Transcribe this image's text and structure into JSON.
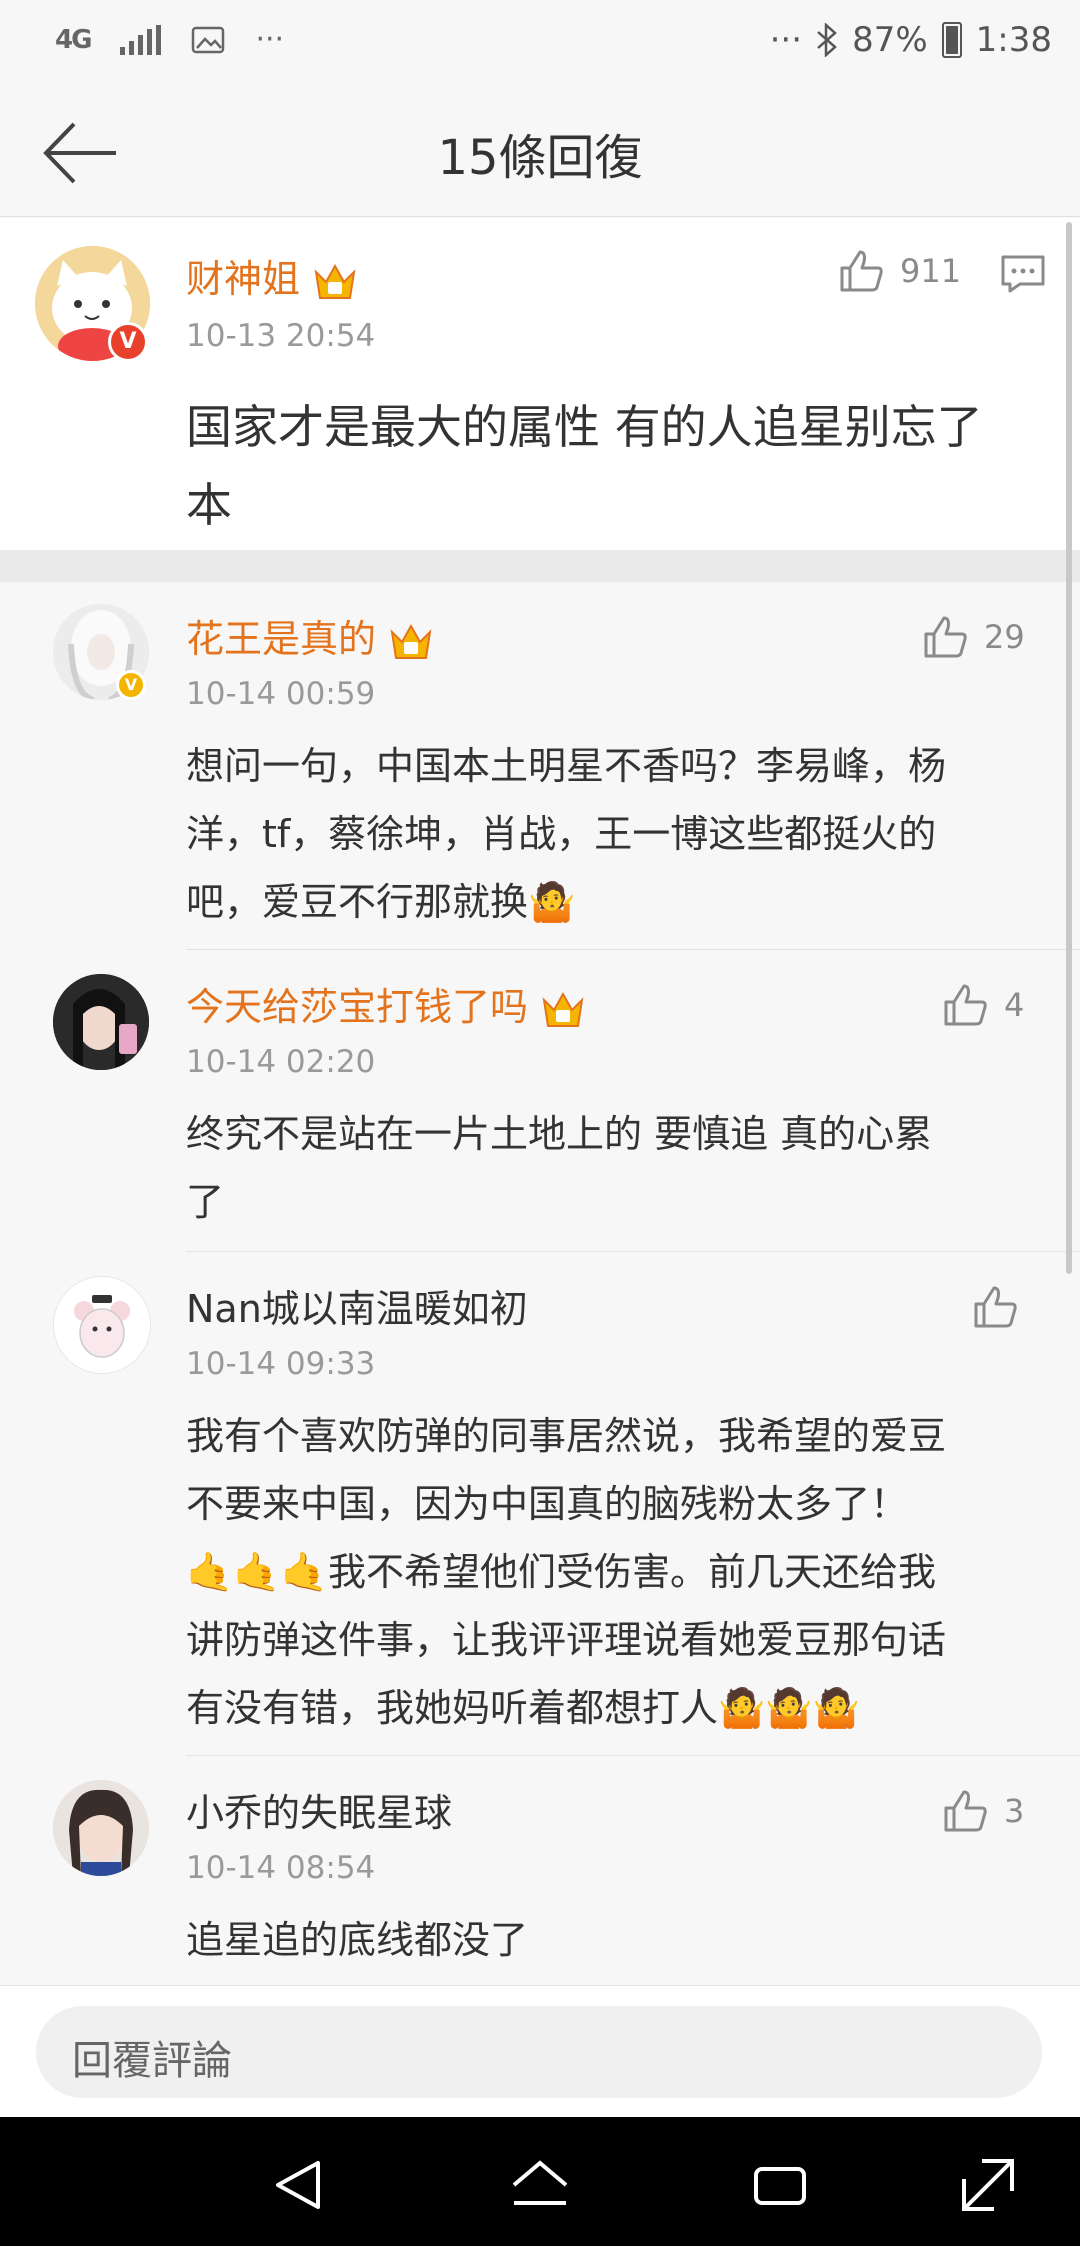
{
  "status_bar": {
    "network": "4G",
    "more_left": "···",
    "more_right": "···",
    "battery": "87%",
    "time": "1:38"
  },
  "header": {
    "title": "15條回復"
  },
  "main_comment": {
    "user": "财神姐",
    "time": "10-13 20:54",
    "likes": "911",
    "text_lines": [
      "国家才是最大的属性 有的人追星别忘了",
      "本"
    ]
  },
  "replies": [
    {
      "user": "花王是真的",
      "time": "10-14 00:59",
      "likes": "29",
      "text_lines": [
        "想问一句，中国本土明星不香吗？李易峰，杨",
        "洋，tf，蔡徐坤，肖战，王一博这些都挺火的",
        "吧，爱豆不行那就换🤷"
      ]
    },
    {
      "user": "今天给莎宝打钱了吗",
      "time": "10-14 02:20",
      "likes": "4",
      "text_lines": [
        "终究不是站在一片土地上的 要慎追 真的心累",
        "了"
      ]
    },
    {
      "user": "Nan城以南温暖如初",
      "time": "10-14 09:33",
      "likes": "",
      "text_lines": [
        "我有个喜欢防弹的同事居然说，我希望的爱豆",
        "不要来中国，因为中国真的脑残粉太多了！",
        "🤙🤙🤙我不希望他们受伤害。前几天还给我",
        "讲防弹这件事，让我评评理说看她爱豆那句话",
        "有没有错，我她妈听着都想打人🤷🤷🤷"
      ]
    },
    {
      "user": "小乔的失眠星球",
      "time": "10-14 08:54",
      "likes": "3",
      "text_lines": [
        "追星追的底线都没了"
      ]
    }
  ],
  "input": {
    "placeholder": "回覆評論"
  },
  "colors": {
    "username": "#e3741d",
    "crown": "#f5b400",
    "vip_red": "#e8402a",
    "vip_gold": "#f5b400"
  }
}
